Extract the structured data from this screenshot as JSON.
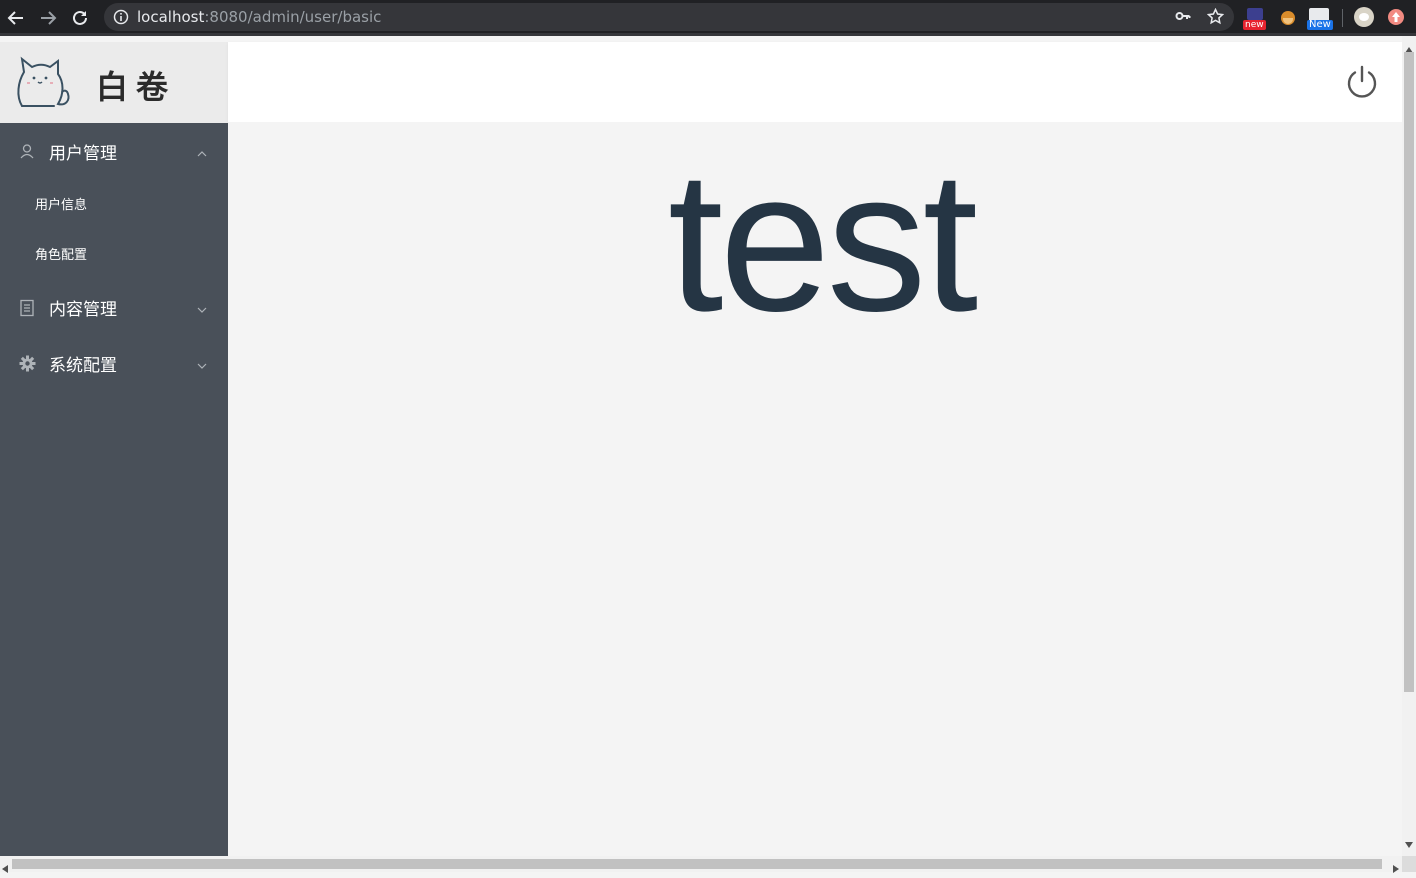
{
  "browser": {
    "url_host": "localhost",
    "url_rest": ":8080/admin/user/basic",
    "ext_badge_1": "new",
    "ext_badge_2": "New"
  },
  "sidebar": {
    "logo_text": "白卷",
    "groups": [
      {
        "label": "用户管理",
        "icon": "user-icon",
        "expanded": true,
        "items": [
          {
            "label": "用户信息"
          },
          {
            "label": "角色配置"
          }
        ]
      },
      {
        "label": "内容管理",
        "icon": "document-icon",
        "expanded": false
      },
      {
        "label": "系统配置",
        "icon": "gear-icon",
        "expanded": false
      }
    ]
  },
  "header": {
    "logout_icon": "power-icon"
  },
  "main": {
    "text": "test"
  },
  "colors": {
    "sidebar_bg": "#495059",
    "logo_bg": "#ebebeb",
    "main_text": "#253544",
    "page_bg": "#f4f4f4"
  }
}
